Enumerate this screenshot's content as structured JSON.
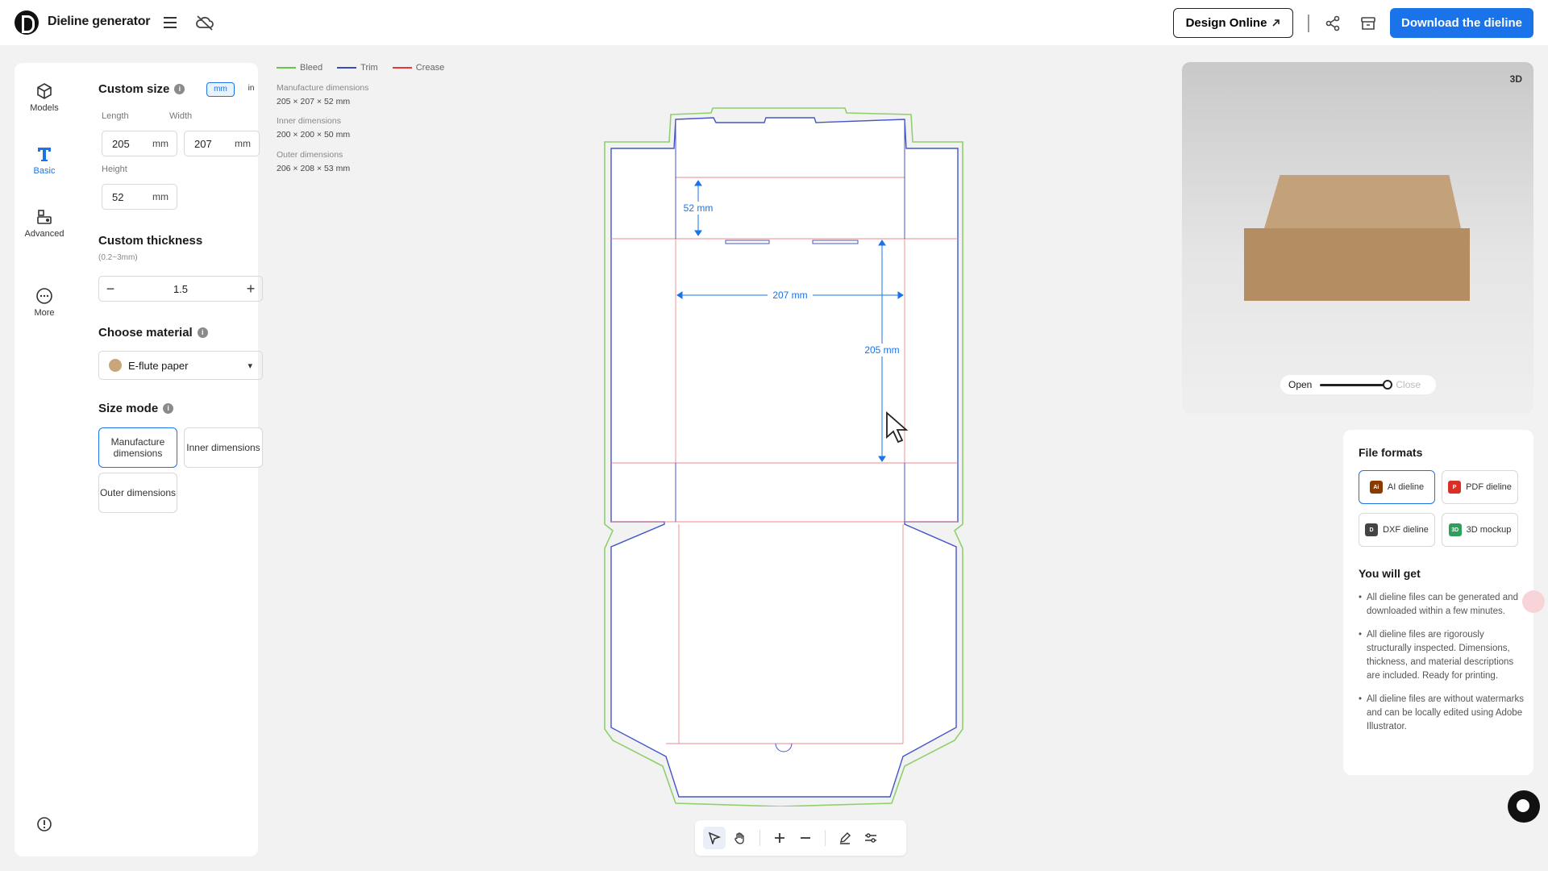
{
  "header": {
    "app_title": "Dieline generator",
    "design_online": "Design Online",
    "download": "Download the dieline"
  },
  "rail": {
    "items": [
      {
        "label": "Models",
        "icon": "cube-icon"
      },
      {
        "label": "Basic",
        "icon": "text-t-icon"
      },
      {
        "label": "Advanced",
        "icon": "shapes-icon"
      },
      {
        "label": "More",
        "icon": "more-icon"
      }
    ]
  },
  "custom_size": {
    "title": "Custom size",
    "units": [
      "mm",
      "in"
    ],
    "active_unit": "mm",
    "length_label": "Length",
    "length_value": "205",
    "width_label": "Width",
    "width_value": "207",
    "height_label": "Height",
    "height_value": "52",
    "unit": "mm"
  },
  "thickness": {
    "title": "Custom thickness",
    "range": "(0.2~3mm)",
    "value": "1.5",
    "minus": "−",
    "plus": "+"
  },
  "material": {
    "title": "Choose material",
    "value": "E-flute paper",
    "swatch_color": "#c9a57a"
  },
  "size_mode": {
    "title": "Size mode",
    "options": [
      "Manufacture dimensions",
      "Inner dimensions",
      "Outer dimensions"
    ],
    "selected": "Manufacture dimensions"
  },
  "legend": {
    "bleed": "Bleed",
    "trim": "Trim",
    "crease": "Crease",
    "bleed_color": "#6cc24a",
    "trim_color": "#3b4cc0",
    "crease_color": "#e53935"
  },
  "dimensions": {
    "manufacture_label": "Manufacture dimensions",
    "manufacture_value": "205 × 207 × 52 mm",
    "inner_label": "Inner dimensions",
    "inner_value": "200 × 200 × 50 mm",
    "outer_label": "Outer dimensions",
    "outer_value": "206 × 208 × 53 mm"
  },
  "dieline": {
    "height_label": "52 mm",
    "width_label": "207 mm",
    "length_label": "205 mm",
    "accent": "#1a73e8"
  },
  "preview": {
    "badge": "3D",
    "open_label": "Open",
    "close_label": "Close",
    "open_fraction": 1.0
  },
  "file_formats": {
    "title": "File formats",
    "buttons": [
      "AI dieline",
      "PDF dieline",
      "DXF dieline",
      "3D mockup"
    ],
    "selected": "AI dieline",
    "benefits_title": "You will get",
    "benefits": [
      "All dieline files can be generated and downloaded within a few minutes.",
      "All dieline files are rigorously structurally inspected. Dimensions, thickness, and material descriptions are included. Ready for printing.",
      "All dieline files are without watermarks and can be locally edited using Adobe Illustrator."
    ]
  }
}
